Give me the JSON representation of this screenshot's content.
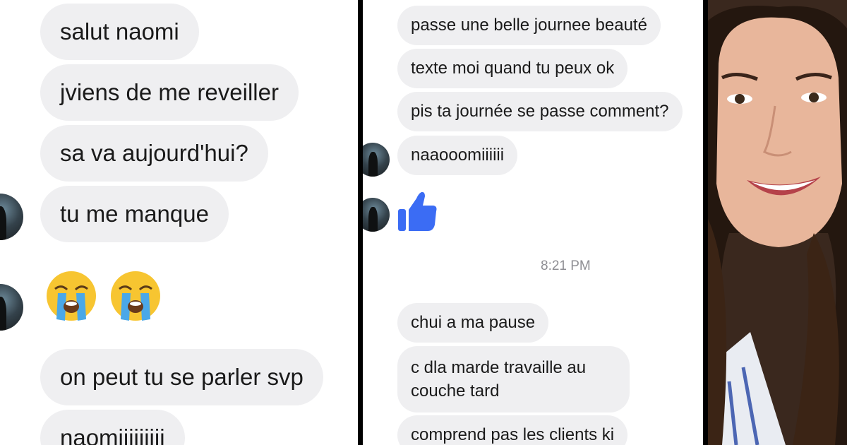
{
  "left_chat": {
    "messages": [
      "salut naomi",
      "jviens de me reveiller",
      "sa va aujourd'hui?",
      "tu me manque",
      "on peut tu se parler svp",
      "naomiiiiiiiii"
    ],
    "emojis": [
      "loudly-crying-face",
      "loudly-crying-face"
    ]
  },
  "right_chat": {
    "messages_top": [
      "passe une belle journee beauté",
      "texte moi quand tu peux ok",
      "pis ta journée se passe comment?",
      "naaooomiiiiii"
    ],
    "reaction": "thumbs-up",
    "timestamp": "8:21 PM",
    "messages_bottom": [
      "chui a ma pause",
      "c dla marde travaille au couche tard",
      "comprend pas les clients ki"
    ]
  },
  "colors": {
    "bubble": "#efeff1",
    "text": "#1a1a1a",
    "timestamp": "#8e8e93",
    "like_blue": "#3b6cf4",
    "divider": "#000000"
  }
}
